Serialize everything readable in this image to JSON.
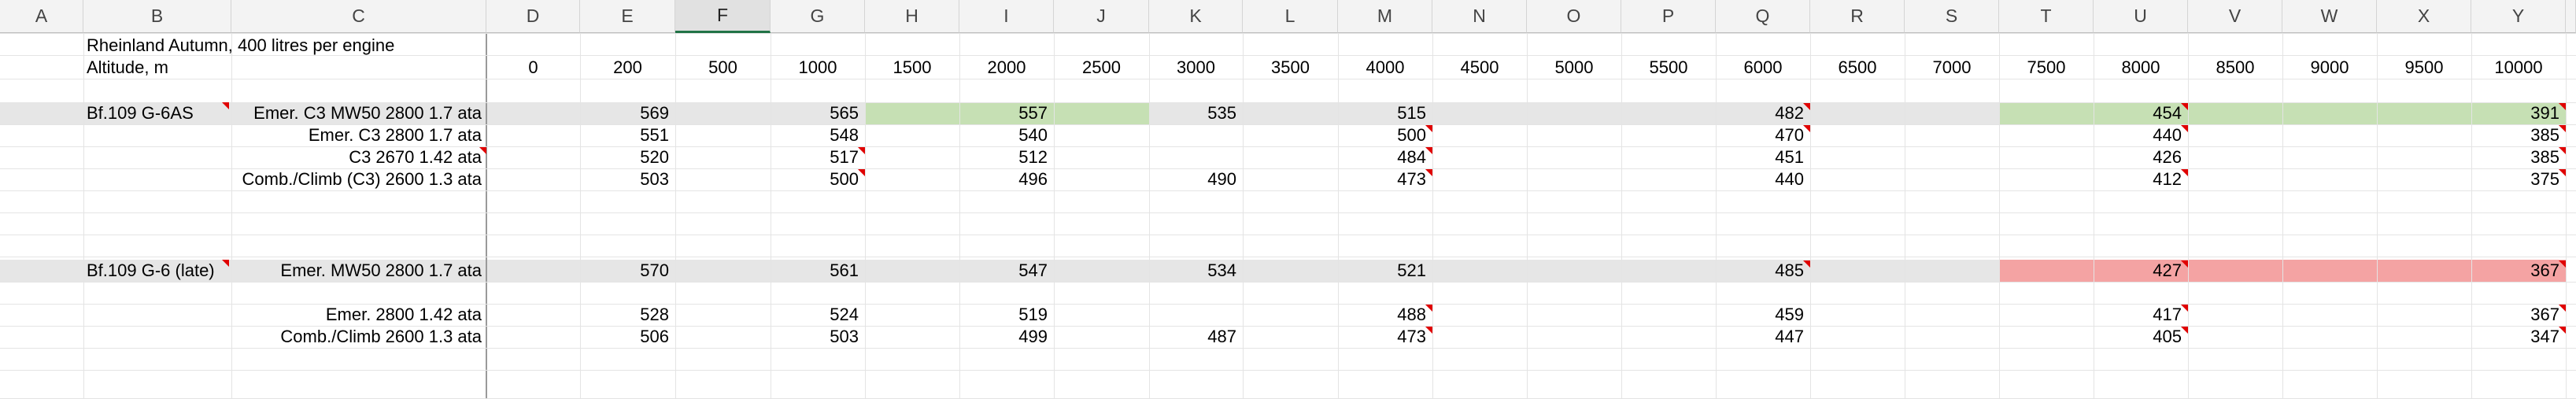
{
  "sheet": {
    "columns": [
      "A",
      "B",
      "C",
      "D",
      "E",
      "F",
      "G",
      "H",
      "I",
      "J",
      "K",
      "L",
      "M",
      "N",
      "O",
      "P",
      "Q",
      "R",
      "S",
      "T",
      "U",
      "V",
      "W",
      "X",
      "Y"
    ],
    "selected_column": "F",
    "colors": {
      "header_bg": "#f3f3f3",
      "selected_header_bg": "#e1e1e1",
      "selected_accent": "#217346",
      "row_band": "#e6e6e6",
      "highlight_green": "#c6e0b4",
      "highlight_red": "#f4a3a3",
      "comment_marker": "#e00000"
    },
    "title": "Rheinland Autumn, 400 litres per engine",
    "altitude_label": "Altitude, m",
    "altitudes": [
      "0",
      "200",
      "500",
      "1000",
      "1500",
      "2000",
      "2500",
      "3000",
      "3500",
      "4000",
      "4500",
      "5000",
      "5500",
      "6000",
      "6500",
      "7000",
      "7500",
      "8000",
      "8500",
      "9000",
      "9500",
      "10000"
    ],
    "groups": [
      {
        "aircraft": "Bf.109 G-6AS",
        "rows": [
          {
            "label": "Emer. C3 MW50 2800 1.7 ata",
            "values": {
              "E": "569",
              "G": "565",
              "I": "557",
              "K": "535",
              "M": "515",
              "Q": "482",
              "U": "454",
              "Y": "391"
            }
          },
          {
            "label": "Emer. C3 2800 1.7 ata",
            "values": {
              "E": "551",
              "G": "548",
              "I": "540",
              "M": "500",
              "Q": "470",
              "U": "440",
              "Y": "385"
            }
          },
          {
            "label": "C3 2670 1.42 ata",
            "values": {
              "E": "520",
              "G": "517",
              "I": "512",
              "M": "484",
              "Q": "451",
              "U": "426",
              "Y": "385"
            }
          },
          {
            "label": "Comb./Climb (C3) 2600 1.3 ata",
            "values": {
              "E": "503",
              "G": "500",
              "I": "496",
              "K": "490",
              "M": "473",
              "Q": "440",
              "U": "412",
              "Y": "375"
            }
          }
        ]
      },
      {
        "aircraft": "Bf.109 G-6 (late)",
        "rows": [
          {
            "label": "Emer. MW50 2800 1.7 ata",
            "values": {
              "E": "570",
              "G": "561",
              "I": "547",
              "K": "534",
              "M": "521",
              "Q": "485",
              "U": "427",
              "Y": "367"
            }
          },
          {
            "label": "Emer. 2800 1.42 ata",
            "values": {
              "E": "528",
              "G": "524",
              "I": "519",
              "M": "488",
              "Q": "459",
              "U": "417",
              "Y": "367"
            }
          },
          {
            "label": "Comb./Climb 2600 1.3 ata",
            "values": {
              "E": "506",
              "G": "503",
              "I": "499",
              "K": "487",
              "M": "473",
              "Q": "447",
              "U": "405",
              "Y": "347"
            }
          }
        ]
      }
    ]
  }
}
